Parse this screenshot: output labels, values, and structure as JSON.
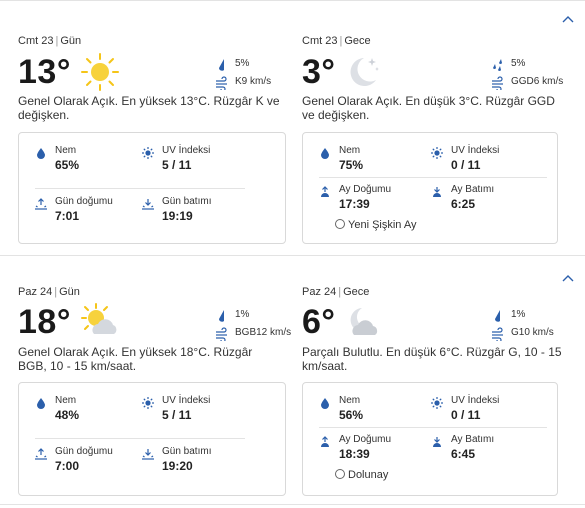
{
  "days": [
    {
      "day": {
        "label_date": "Cmt 23",
        "label_period": "Gün",
        "temp": "13°",
        "icon": "sun-icon",
        "precip": "5%",
        "wind": "K9 km/s",
        "summary": "Genel Olarak Açık. En yüksek 13°C. Rüzgâr K ve değişken.",
        "humidity_label": "Nem",
        "humidity": "65%",
        "uv_label": "UV İndeksi",
        "uv": "5 / 11",
        "rise_label": "Gün doğumu",
        "rise": "7:01",
        "set_label": "Gün batımı",
        "set": "19:19"
      },
      "night": {
        "label_date": "Cmt 23",
        "label_period": "Gece",
        "temp": "3°",
        "icon": "moon-stars-icon",
        "precip": "5%",
        "wind": "GGD6 km/s",
        "summary": "Genel Olarak Açık. En düşük 3°C. Rüzgâr GGD ve değişken.",
        "humidity_label": "Nem",
        "humidity": "75%",
        "uv_label": "UV İndeksi",
        "uv": "0 / 11",
        "rise_label": "Ay Doğumu",
        "rise": "17:39",
        "set_label": "Ay Batımı",
        "set": "6:25",
        "moon_phase": "Yeni Şişkin Ay"
      }
    },
    {
      "day": {
        "label_date": "Paz 24",
        "label_period": "Gün",
        "temp": "18°",
        "icon": "sun-cloud-icon",
        "precip": "1%",
        "wind": "BGB12 km/s",
        "summary": "Genel Olarak Açık. En yüksek 18°C. Rüzgâr BGB, 10 - 15 km/saat.",
        "humidity_label": "Nem",
        "humidity": "48%",
        "uv_label": "UV İndeksi",
        "uv": "5 / 11",
        "rise_label": "Gün doğumu",
        "rise": "7:00",
        "set_label": "Gün batımı",
        "set": "19:20"
      },
      "night": {
        "label_date": "Paz 24",
        "label_period": "Gece",
        "temp": "6°",
        "icon": "moon-cloud-icon",
        "precip": "1%",
        "wind": "G10 km/s",
        "summary": "Parçalı Bulutlu. En düşük 6°C. Rüzgâr G, 10 - 15 km/saat.",
        "humidity_label": "Nem",
        "humidity": "56%",
        "uv_label": "UV İndeksi",
        "uv": "0 / 11",
        "rise_label": "Ay Doğumu",
        "rise": "18:39",
        "set_label": "Ay Batımı",
        "set": "6:45",
        "moon_phase": "Dolunay"
      }
    }
  ],
  "colors": {
    "accent": "#2b5fab",
    "sun": "#f5c518",
    "moon": "#cfd3da",
    "cloud": "#d4d8de"
  }
}
